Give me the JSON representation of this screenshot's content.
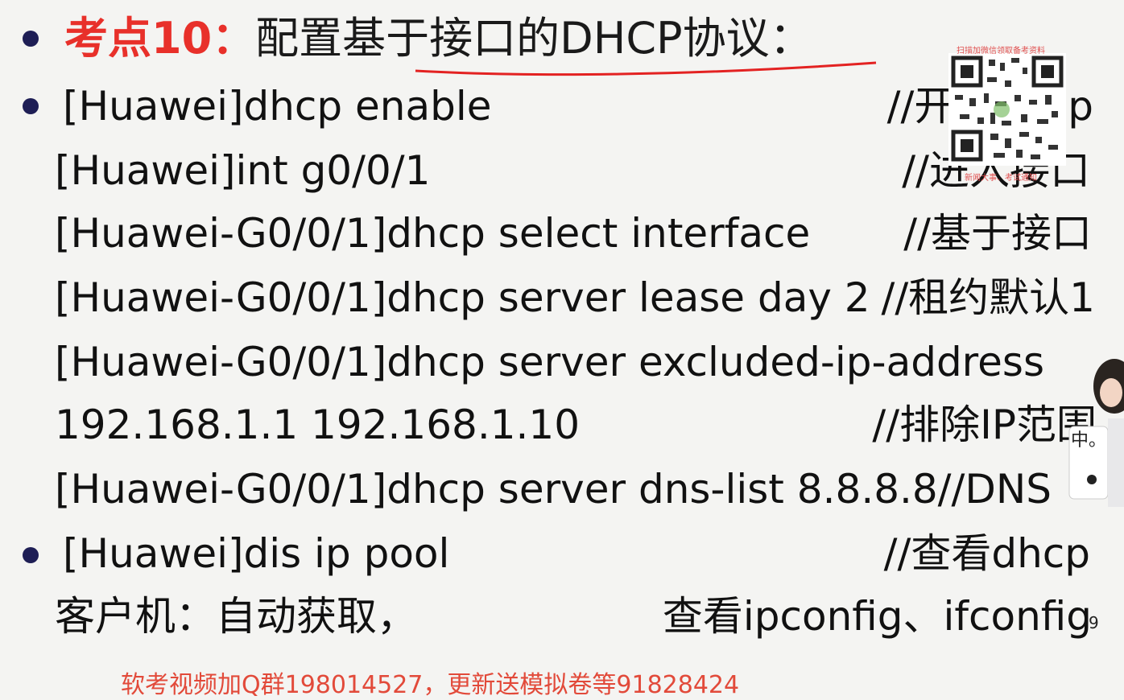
{
  "title": {
    "prefix": "考点10：",
    "text": "配置基于接口的DHCP协议："
  },
  "lines": [
    {
      "cmd": "[Huawei]dhcp enable",
      "comment": "//开启dhcp"
    },
    {
      "cmd": "[Huawei]int g0/0/1",
      "comment": "//进入接口"
    },
    {
      "cmd": "[Huawei-G0/0/1]dhcp select interface",
      "comment": "//基于接口"
    },
    {
      "cmd": "[Huawei-G0/0/1]dhcp server lease day 2",
      "comment": "//租约默认1"
    },
    {
      "cmd": "[Huawei-G0/0/1]dhcp server excluded-ip-address",
      "comment": ""
    },
    {
      "cmd": "192.168.1.1 192.168.1.10",
      "comment": "//排除IP范围"
    },
    {
      "cmd": "[Huawei-G0/0/1]dhcp server dns-list 8.8.8.8",
      "comment": "//DNS"
    },
    {
      "cmd": "[Huawei]dis ip pool",
      "comment": "//查看dhcp"
    },
    {
      "cmd": "客户机：自动获取，",
      "comment": "查看ipconfig、ifconfig"
    }
  ],
  "page_number": "9",
  "footer_text": "软考视频加Q群198014527，更新送模拟卷等91828424",
  "watermark": {
    "top": "扫描加微信领取备考资料",
    "bottom": "新闻大事、考试通知"
  },
  "avatar_caption": "中。",
  "colors": {
    "title_red": "#e8302a",
    "bullet": "#1e1e55",
    "underline": "#e32222",
    "footer": "#e24a3a"
  }
}
